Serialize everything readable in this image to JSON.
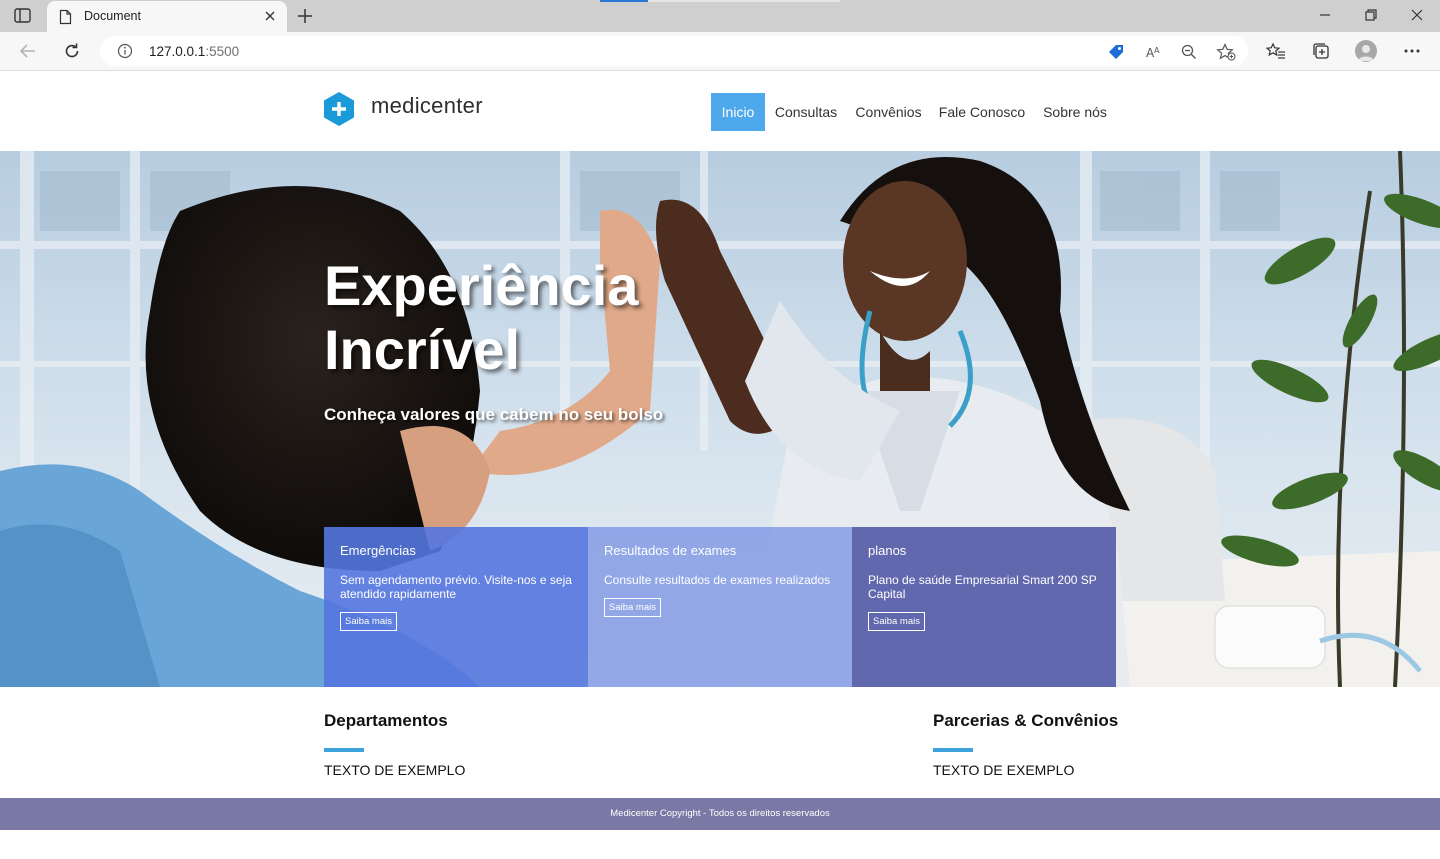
{
  "browser": {
    "tab_title": "Document",
    "url_host": "127.0.0.1",
    "url_port": ":5500"
  },
  "site": {
    "logo_text": "medicenter",
    "nav": [
      {
        "label": "Inicio",
        "active": true
      },
      {
        "label": "Consultas",
        "active": false
      },
      {
        "label": "Convênios",
        "active": false
      },
      {
        "label": "Fale Conosco",
        "active": false
      },
      {
        "label": "Sobre nós",
        "active": false
      }
    ]
  },
  "hero": {
    "title_line1": "Experiência",
    "title_line2": "Incrível",
    "subtitle": "Conheça valores que cabem no seu bolso"
  },
  "cards": [
    {
      "title": "Emergências",
      "text": "Sem agendamento prévio. Visite-nos e seja atendido rapidamente",
      "button": "Saiba mais"
    },
    {
      "title": "Resultados de exames",
      "text": "Consulte resultados de exames realizados",
      "button": "Saiba mais"
    },
    {
      "title": "planos",
      "text": "Plano de saúde Empresarial Smart 200 SP Capital",
      "button": "Saiba mais"
    }
  ],
  "sections": {
    "left": {
      "title": "Departamentos",
      "text": "TEXTO DE EXEMPLO"
    },
    "right": {
      "title": "Parcerias & Convênios",
      "text": "TEXTO DE EXEMPLO"
    }
  },
  "footer": {
    "text": "Medicenter Copyright - Todos os direitos reservados"
  },
  "colors": {
    "nav_active": "#4da8ec",
    "accent_bar": "#3ea2dd",
    "footer_bg": "#7a78a5",
    "logo_hex": "#1a9ad8"
  }
}
